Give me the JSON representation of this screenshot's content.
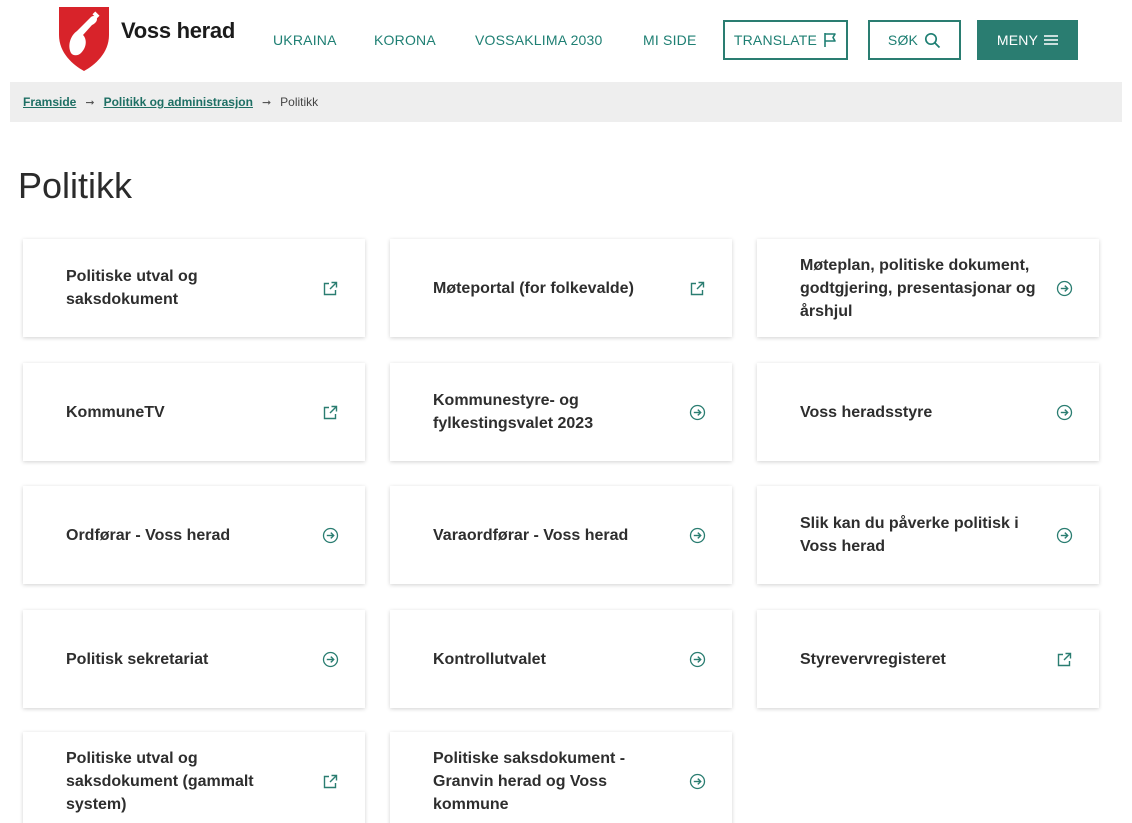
{
  "header": {
    "logo_text": "Voss herad",
    "nav": [
      "UKRAINA",
      "KORONA",
      "VOSSAKLIMA 2030",
      "MI SIDE"
    ],
    "translate_label": "TRANSLATE",
    "search_label": "SØK",
    "menu_label": "MENY",
    "colors": {
      "accent": "#2a7d71",
      "logo_red": "#d8232a"
    }
  },
  "breadcrumb": {
    "items": [
      "Framside",
      "Politikk og administrasjon"
    ],
    "current": "Politikk"
  },
  "page": {
    "title": "Politikk"
  },
  "cards": [
    {
      "label": "Politiske utval og saksdokument",
      "icon": "external-link-icon"
    },
    {
      "label": "Møteportal (for folkevalde)",
      "icon": "external-link-icon"
    },
    {
      "label": "Møteplan, politiske dokument, godtgjering, presentasjonar og årshjul",
      "icon": "arrow-right-circle-icon"
    },
    {
      "label": "KommuneTV",
      "icon": "external-link-icon"
    },
    {
      "label": "Kommunestyre- og fylkestingsvalet 2023",
      "icon": "arrow-right-circle-icon"
    },
    {
      "label": "Voss heradsstyre",
      "icon": "arrow-right-circle-icon"
    },
    {
      "label": "Ordførar - Voss herad",
      "icon": "arrow-right-circle-icon"
    },
    {
      "label": "Varaordførar - Voss herad",
      "icon": "arrow-right-circle-icon"
    },
    {
      "label": "Slik kan du påverke politisk i Voss herad",
      "icon": "arrow-right-circle-icon"
    },
    {
      "label": "Politisk sekretariat",
      "icon": "arrow-right-circle-icon"
    },
    {
      "label": "Kontrollutvalet",
      "icon": "arrow-right-circle-icon"
    },
    {
      "label": "Styrevervregisteret",
      "icon": "external-link-icon"
    },
    {
      "label": "Politiske utval og saksdokument (gammalt system)",
      "icon": "external-link-icon"
    },
    {
      "label": "Politiske saksdokument - Granvin herad og Voss kommune",
      "icon": "arrow-right-circle-icon"
    }
  ]
}
